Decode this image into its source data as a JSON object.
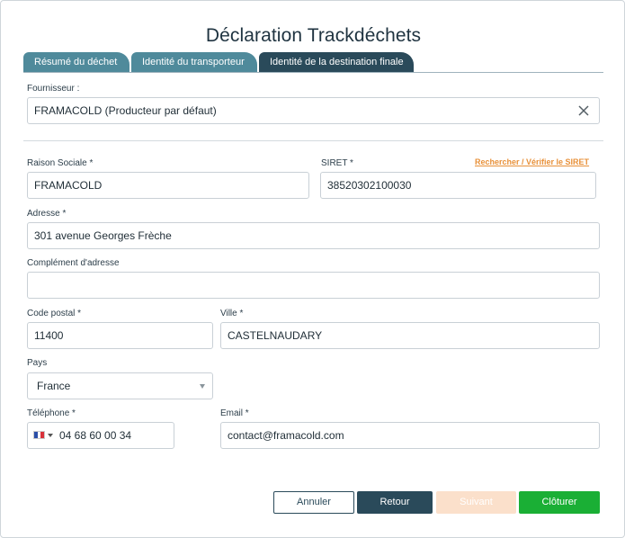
{
  "dialog": {
    "title": "Déclaration Trackdéchets"
  },
  "tabs": [
    {
      "label": "Résumé du déchet"
    },
    {
      "label": "Identité du transporteur"
    },
    {
      "label": "Identité de la destination finale"
    }
  ],
  "supplier": {
    "label": "Fournisseur :",
    "value": "FRAMACOLD (Producteur par défaut)"
  },
  "form": {
    "raison_sociale": {
      "label": "Raison Sociale *",
      "value": "FRAMACOLD"
    },
    "siret": {
      "label": "SIRET *",
      "value": "38520302100030",
      "link": "Rechercher / Vérifier le SIRET"
    },
    "adresse": {
      "label": "Adresse *",
      "value": "301 avenue Georges Frèche"
    },
    "complement": {
      "label": "Complément d'adresse",
      "value": ""
    },
    "code_postal": {
      "label": "Code postal *",
      "value": "11400"
    },
    "ville": {
      "label": "Ville *",
      "value": "CASTELNAUDARY"
    },
    "pays": {
      "label": "Pays",
      "value": "France"
    },
    "telephone": {
      "label": "Téléphone *",
      "value": "04 68 60 00 34"
    },
    "email": {
      "label": "Email *",
      "value": "contact@framacold.com"
    }
  },
  "buttons": {
    "cancel": "Annuler",
    "back": "Retour",
    "next": "Suivant",
    "close": "Clôturer"
  },
  "icons": {
    "clear": "close-icon",
    "flag": "france-flag-icon",
    "select_arrow": "chevron-down-icon"
  },
  "colors": {
    "tab": "#4f8a9b",
    "tab_active": "#2a4a5a",
    "link": "#e8913a",
    "primary_dark": "#2a4a5a",
    "next_disabled": "#fbe0cb",
    "success": "#1aaf35"
  }
}
